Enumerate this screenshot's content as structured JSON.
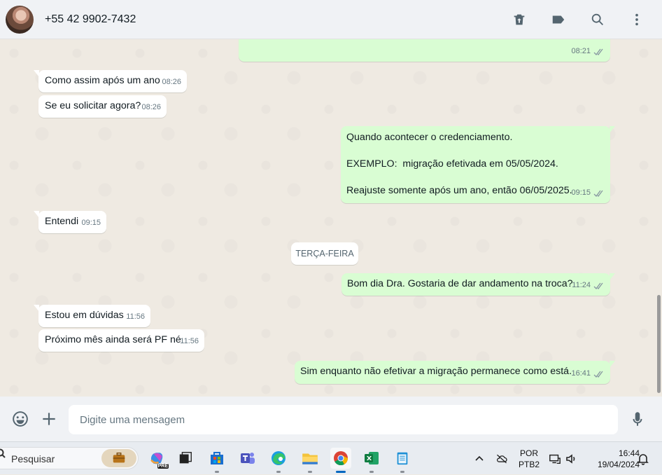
{
  "header": {
    "contact_name": "+55 42 9902-7432",
    "icons": [
      "delete-icon",
      "label-icon",
      "search-icon",
      "menu-icon"
    ]
  },
  "messages": [
    {
      "dir": "out",
      "text": "",
      "time": "08:21",
      "status": "read"
    },
    {
      "dir": "in",
      "text": "Como assim após um ano",
      "time": "08:26"
    },
    {
      "dir": "in",
      "text": "Se eu solicitar agora?",
      "time": "08:26"
    },
    {
      "dir": "out",
      "line1": "Quando acontecer o credenciamento.",
      "line2": "EXEMPLO:  migração efetivada em 05/05/2024.",
      "line3": "Reajuste somente após um ano, então 06/05/2025.",
      "time": "09:15",
      "status": "read"
    },
    {
      "dir": "in",
      "text": "Entendi",
      "time": "09:15"
    },
    {
      "dir": "out",
      "text": "Bom dia Dra. Gostaria de dar andamento na troca?",
      "time": "11:24",
      "status": "read"
    },
    {
      "dir": "in",
      "text": "Estou em dúvidas",
      "time": "11:56"
    },
    {
      "dir": "in",
      "text": "Próximo mês ainda será PF né",
      "time": "11:56"
    },
    {
      "dir": "out",
      "text": "Sim enquanto não efetivar a migração permanece como está.",
      "time": "16:41",
      "status": "read"
    }
  ],
  "day_separator": "TERÇA-FEIRA",
  "composer": {
    "placeholder": "Digite uma mensagem",
    "icons": [
      "emoji-icon",
      "attach-plus-icon",
      "microphone-icon"
    ]
  },
  "taskbar": {
    "search_label": "Pesquisar",
    "apps": [
      "widgets",
      "copilot",
      "task-view",
      "store",
      "teams",
      "edge",
      "file-explorer",
      "chrome",
      "excel",
      "notepad"
    ],
    "copilot_badge": "PRE",
    "language": {
      "line1": "POR",
      "line2": "PTB2"
    },
    "time": "16:44",
    "date": "19/04/2024"
  },
  "colors": {
    "chat_bg": "#efeae2",
    "bubble_in": "#ffffff",
    "bubble_out": "#d9fdd3",
    "header_bg": "#f0f2f5",
    "text": "#111b21",
    "meta": "#667781"
  }
}
